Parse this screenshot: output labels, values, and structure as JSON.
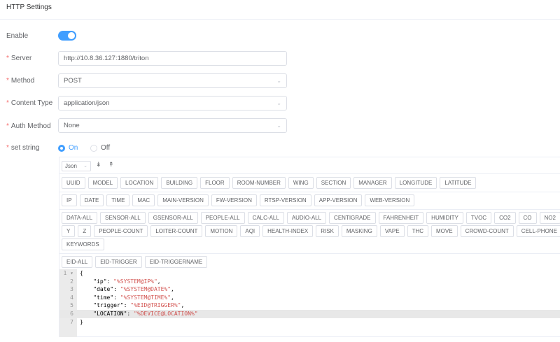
{
  "header": {
    "title": "HTTP Settings"
  },
  "form": {
    "enable": {
      "label": "Enable",
      "value": true
    },
    "server": {
      "label": "Server",
      "value": "http://10.8.36.127:1880/triton"
    },
    "method": {
      "label": "Method",
      "value": "POST"
    },
    "content_type": {
      "label": "Content Type",
      "value": "application/json"
    },
    "auth_method": {
      "label": "Auth Method",
      "value": "None"
    },
    "set_string": {
      "label": "set string",
      "options": [
        "On",
        "Off"
      ],
      "selected": "On"
    }
  },
  "editor": {
    "format": "Json",
    "rows": [
      [
        "UUID",
        "MODEL",
        "LOCATION",
        "BUILDING",
        "FLOOR",
        "ROOM-NUMBER",
        "WING",
        "SECTION",
        "MANAGER",
        "LONGITUDE",
        "LATITUDE"
      ],
      [
        "IP",
        "DATE",
        "TIME",
        "MAC",
        "MAIN-VERSION",
        "FW-VERSION",
        "RTSP-VERSION",
        "APP-VERSION",
        "WEB-VERSION"
      ],
      [
        "DATA-ALL",
        "SENSOR-ALL",
        "GSENSOR-ALL",
        "PEOPLE-ALL",
        "CALC-ALL",
        "AUDIO-ALL",
        "CENTIGRADE",
        "FAHRENHEIT",
        "HUMIDITY",
        "TVOC",
        "CO2",
        "CO",
        "NO2",
        ""
      ],
      [
        "Y",
        "Z",
        "PEOPLE-COUNT",
        "LOITER-COUNT",
        "MOTION",
        "AQI",
        "HEALTH-INDEX",
        "RISK",
        "MASKING",
        "VAPE",
        "THC",
        "MOVE",
        "CROWD-COUNT",
        "CELL-PHONE",
        ""
      ],
      [
        "KEYWORDS"
      ],
      [
        "EID-ALL",
        "EID-TRIGGER",
        "EID-TRIGGERNAME"
      ]
    ],
    "code": [
      {
        "k": "{",
        "v": ""
      },
      {
        "k": "    \"ip\": ",
        "v": "\"%SYSTEM@IP%\"",
        "e": ","
      },
      {
        "k": "    \"date\": ",
        "v": "\"%SYSTEM@DATE%\"",
        "e": ","
      },
      {
        "k": "    \"time\": ",
        "v": "\"%SYSTEM@TIME%\"",
        "e": ","
      },
      {
        "k": "    \"trigger\": ",
        "v": "\"%EID@TRIGGER%\"",
        "e": ","
      },
      {
        "k": "    \"LOCATION\": ",
        "v": "\"%DEVICE@LOCATION%\"",
        "e": ""
      },
      {
        "k": "}",
        "v": ""
      }
    ],
    "active_line": 6
  },
  "colors": {
    "accent": "#409eff",
    "required": "#f56c6c",
    "string": "#c41a16"
  }
}
